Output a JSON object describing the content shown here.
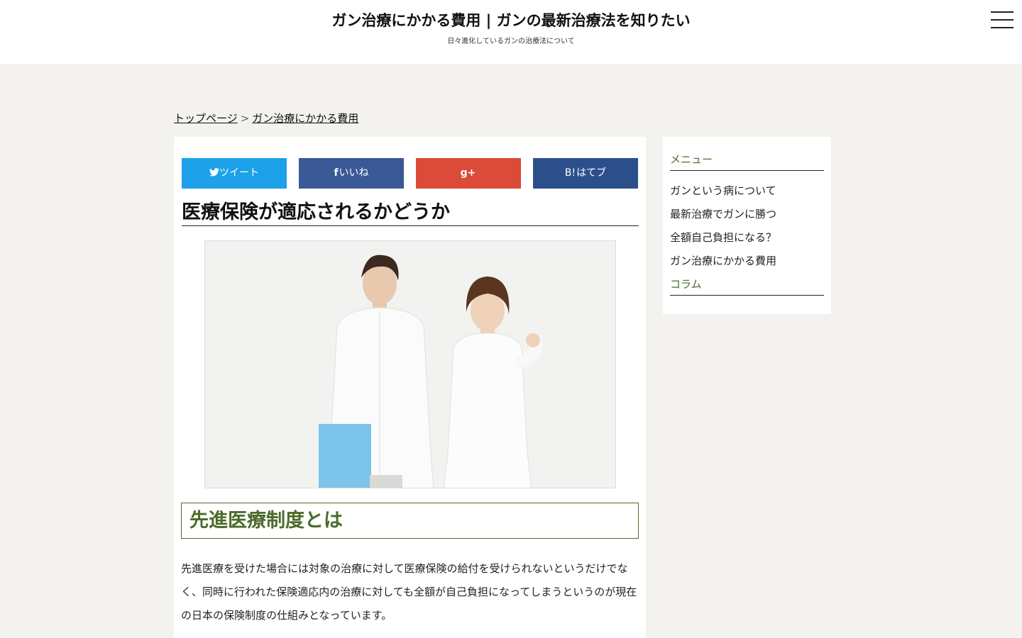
{
  "header": {
    "title": "ガン治療にかかる費用 | ガンの最新治療法を知りたい",
    "tagline": "日々進化しているガンの治療法について"
  },
  "breadcrumb": {
    "home": "トップページ",
    "separator": ">",
    "current": "ガン治療にかかる費用"
  },
  "share": {
    "twitter": {
      "icon": "twitter-bird",
      "label": "ツイート",
      "color": "#1da1e8"
    },
    "facebook": {
      "icon": "f",
      "label": "いいね",
      "color": "#3b5897"
    },
    "google": {
      "icon": "g+",
      "label": "",
      "color": "#dc4a38"
    },
    "hatena": {
      "icon": "B!",
      "label": "はてブ",
      "color": "#2c4f8c"
    }
  },
  "article": {
    "title": "医療保険が適応されるかどうか",
    "section_heading": "先進医療制度とは",
    "paragraph": "先進医療を受けた場合には対象の治療に対して医療保険の給付を受けられないというだけでなく、同時に行われた保険適応内の治療に対しても全額が自己負担になってしまうというのが現在の日本の保険制度の仕組みとなっています。"
  },
  "sidebar": {
    "menu_heading": "メニュー",
    "items": [
      "ガンという病について",
      "最新治療でガンに勝つ",
      "全額自己負担になる？",
      "ガン治療にかかる費用"
    ],
    "column_heading": "コラム"
  },
  "colors": {
    "accent_green": "#4b6b2b",
    "page_bg": "#f3f2ee"
  }
}
